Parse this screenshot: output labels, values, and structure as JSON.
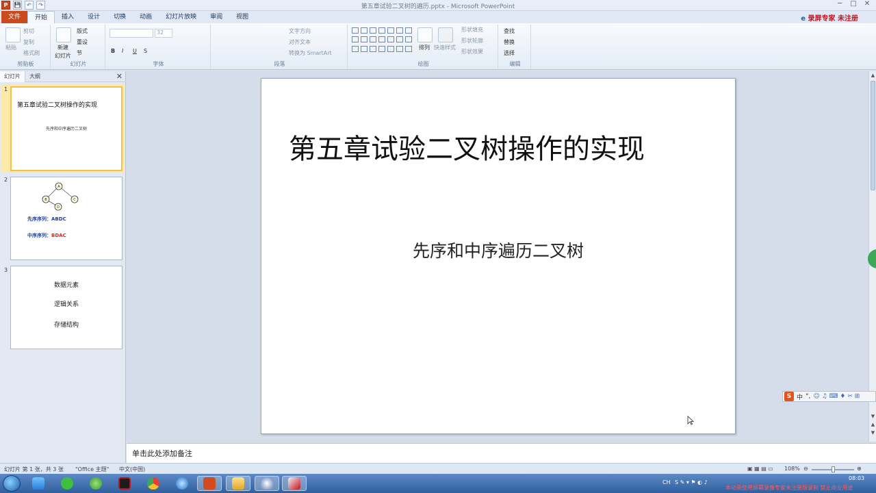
{
  "window": {
    "title": "第五章试验二叉树的遍历.pptx - Microsoft PowerPoint",
    "controls": [
      "─",
      "□",
      "✕"
    ]
  },
  "quick_access": {
    "undo": "↶",
    "redo": "↷",
    "save": "💾"
  },
  "tabs": [
    "文件",
    "开始",
    "插入",
    "设计",
    "切换",
    "动画",
    "幻灯片放映",
    "审阅",
    "视图"
  ],
  "active_tab": "开始",
  "ribbon": {
    "clipboard": {
      "paste": "粘贴",
      "cut": "剪切",
      "copy": "复制",
      "format_painter": "格式刷",
      "label": "剪贴板"
    },
    "slides": {
      "new_slide": "新建",
      "new_slide2": "幻灯片",
      "layout": "版式",
      "reset": "重设",
      "section": "节",
      "label": "幻灯片"
    },
    "font": {
      "size": "32",
      "label": "字体",
      "bold": "B",
      "italic": "I",
      "underline": "U",
      "strike": "S"
    },
    "paragraph": {
      "text_direction": "文字方向",
      "align_text": "对齐文本",
      "smartart": "转换为 SmartArt",
      "label": "段落"
    },
    "drawing": {
      "arrange": "排列",
      "quick_styles": "快速样式",
      "shape_fill": "形状填充",
      "shape_outline": "形状轮廓",
      "shape_effects": "形状效果",
      "label": "绘图"
    },
    "editing": {
      "find": "查找",
      "replace": "替换",
      "select": "选择",
      "label": "编辑"
    },
    "branding": "录屏专家 未注册"
  },
  "panel": {
    "tabs": [
      "幻灯片",
      "大纲"
    ],
    "thumbnails": [
      {
        "num": "1",
        "title": "第五章试验二叉树操作的实现",
        "sub": "先序和中序遍历二叉树"
      },
      {
        "num": "2",
        "nodes": [
          "A",
          "B",
          "C",
          "D"
        ],
        "pre_label": "先序序列：",
        "pre_value": "ABDC",
        "in_label": "中序序列：",
        "in_value": "BDAC"
      },
      {
        "num": "3",
        "items": [
          "数据元素",
          "逻辑关系",
          "存储结构"
        ]
      }
    ]
  },
  "slide": {
    "title": "第五章试验二叉树操作的实现",
    "subtitle": "先序和中序遍历二叉树"
  },
  "notes": {
    "placeholder": "单击此处添加备注"
  },
  "status": {
    "slide_info": "幻灯片 第 1 张，共 3 张",
    "theme": "\"Office 主题\"",
    "language": "中文(中国)",
    "zoom": "108%"
  },
  "ime": {
    "logo": "S",
    "mode": "中",
    "punct": "°,",
    "icons": "☺ ♫ ⌨ ♦ ✂ ⊞"
  },
  "taskbar": {
    "tray_lang": "CH",
    "clock": "08:03",
    "notice": "本动画使用屏幕录像专家未注册版录制 禁止商业用途"
  },
  "colors": {
    "file_tab": "#cb4a1c",
    "selection": "#f1c34a",
    "pre_label": "#1d3fa0",
    "in_value": "#d42a1f"
  }
}
